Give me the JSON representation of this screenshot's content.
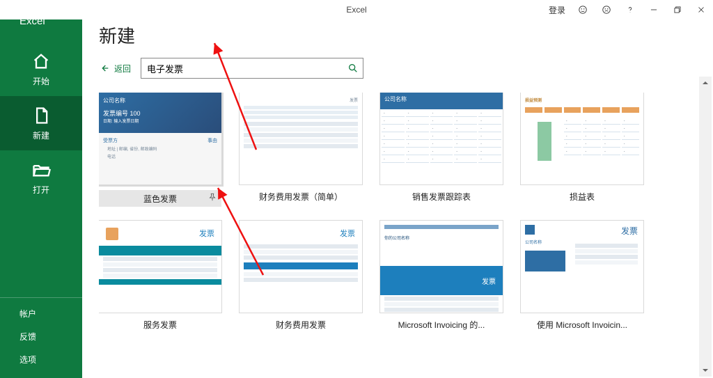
{
  "titlebar": {
    "app_name": "Excel",
    "signin": "登录"
  },
  "sidebar": {
    "brand": "Excel",
    "home": "开始",
    "new": "新建",
    "open": "打开",
    "account": "帐户",
    "feedback": "反馈",
    "options": "选项"
  },
  "page": {
    "title": "新建",
    "back": "返回",
    "search_value": "电子发票"
  },
  "templates": [
    {
      "label": "蓝色发票",
      "selected": true,
      "preview": {
        "company": "公司名称",
        "invoice_no": "发票编号 100",
        "date_hint": "日期: 输入发票日期",
        "bill_to": "受票方",
        "reason": "事由"
      }
    },
    {
      "label": "财务费用发票（简单）",
      "preview": {
        "title": "发票"
      }
    },
    {
      "label": "销售发票跟踪表",
      "preview": {
        "title": "公司名称"
      }
    },
    {
      "label": "损益表",
      "preview": {
        "title": "损益预测"
      }
    },
    {
      "label": "服务发票",
      "preview": {
        "title": "发票"
      }
    },
    {
      "label": "财务费用发票",
      "preview": {
        "title": "发票"
      }
    },
    {
      "label": "Microsoft Invoicing 的...",
      "preview": {
        "company": "你的公司名称",
        "title": "发票"
      }
    },
    {
      "label": "使用 Microsoft Invoicin...",
      "preview": {
        "company": "公司名称",
        "title": "发票"
      }
    }
  ]
}
